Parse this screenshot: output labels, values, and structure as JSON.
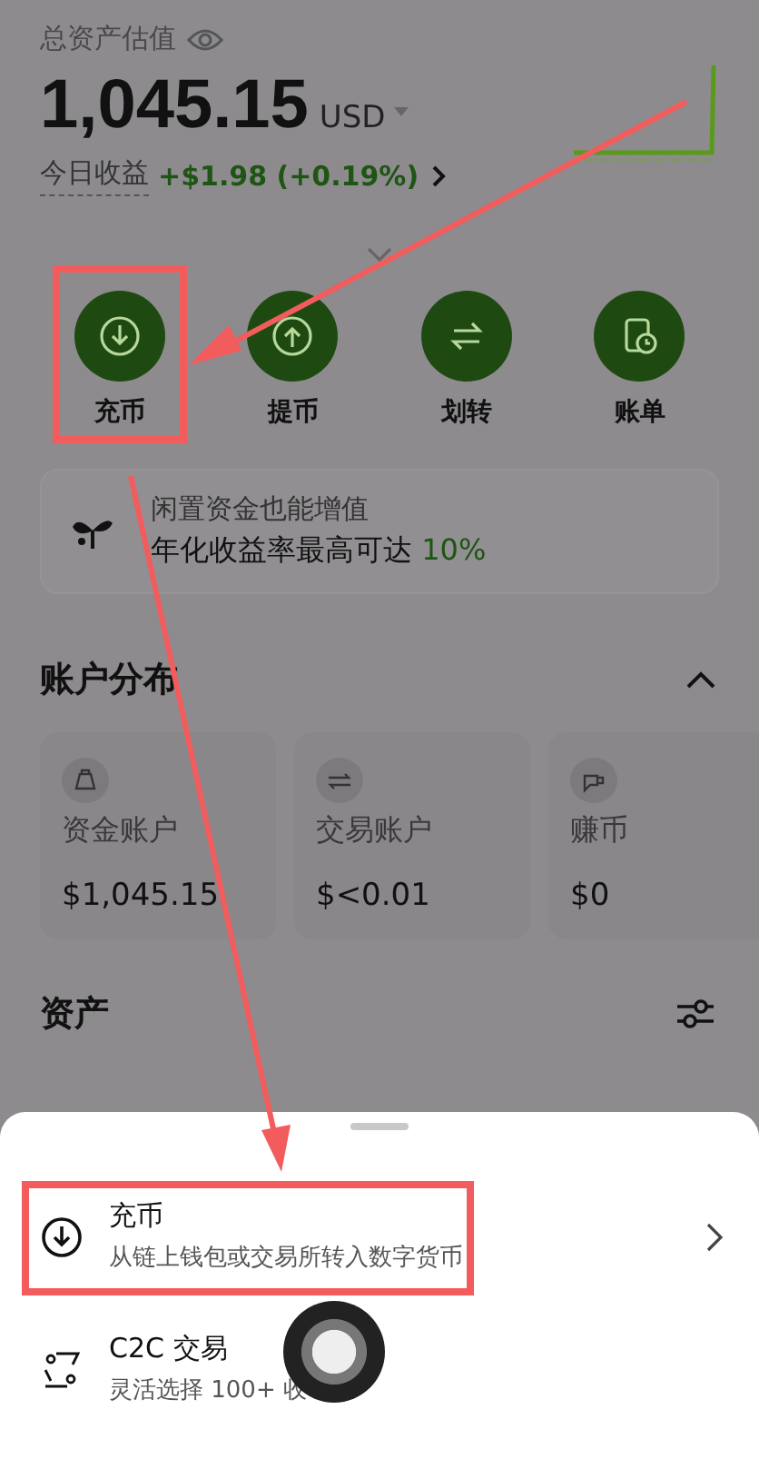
{
  "summary": {
    "label": "总资产估值",
    "amount": "1,045.15",
    "currency": "USD",
    "pnl_label": "今日收益",
    "pnl_value": "+$1.98 (+0.19%)"
  },
  "actions": [
    {
      "kind": "deposit",
      "label": "充币",
      "highlighted": true
    },
    {
      "kind": "withdraw",
      "label": "提币",
      "highlighted": false
    },
    {
      "kind": "transfer",
      "label": "划转",
      "highlighted": false
    },
    {
      "kind": "bill",
      "label": "账单",
      "highlighted": false
    }
  ],
  "promo": {
    "title": "闲置资金也能增值",
    "text": "年化收益率最高可达 ",
    "highlight": "10%"
  },
  "accounts": {
    "title": "账户分布",
    "expanded": true,
    "items": [
      {
        "kind": "funding",
        "name": "资金账户",
        "value": "$1,045.15"
      },
      {
        "kind": "trading",
        "name": "交易账户",
        "value": "$<0.01"
      },
      {
        "kind": "earn",
        "name": "赚币",
        "value": "$0"
      }
    ]
  },
  "assets": {
    "title": "资产"
  },
  "sheet": {
    "items": [
      {
        "kind": "deposit",
        "title": "充币",
        "subtitle": "从链上钱包或交易所转入数字货币",
        "highlighted": true
      },
      {
        "kind": "c2c",
        "title": "C2C 交易",
        "subtitle": "灵活选择 100+ 收",
        "highlighted": false
      }
    ]
  }
}
